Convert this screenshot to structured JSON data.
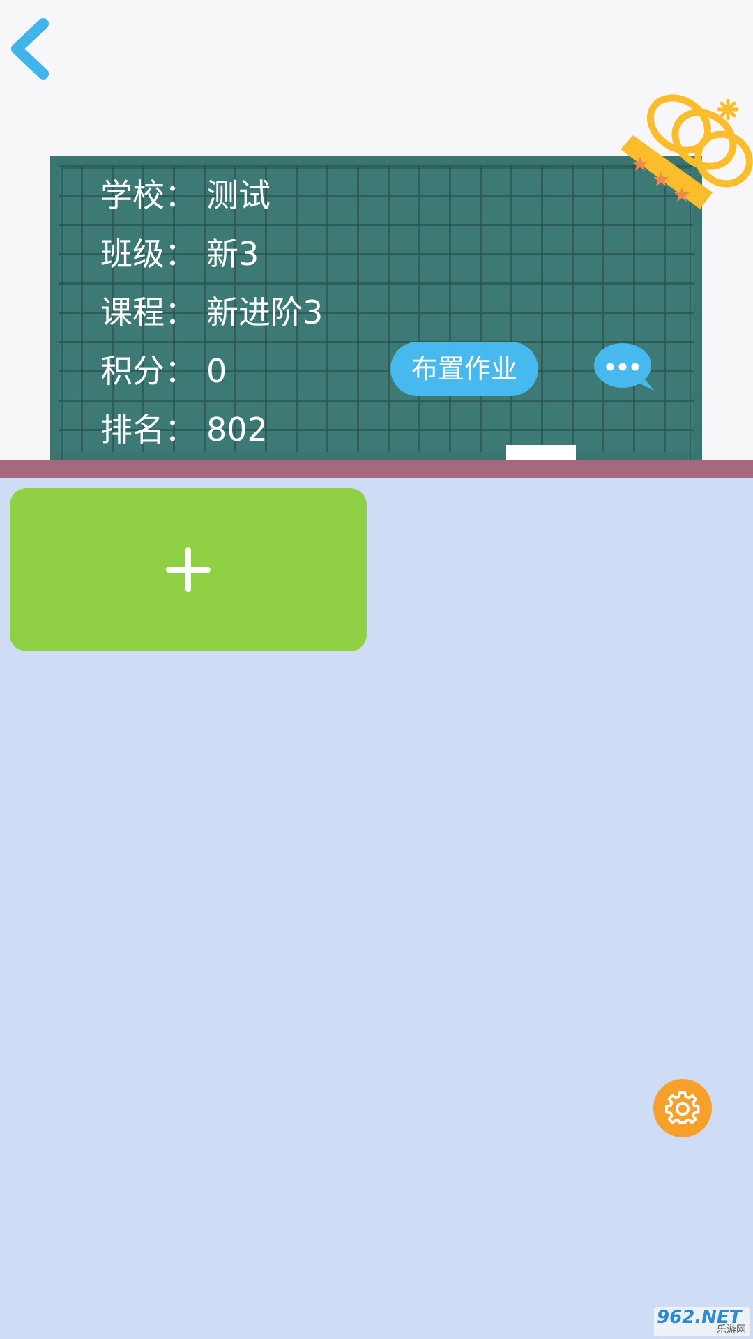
{
  "header": {
    "back_icon": "chevron-left-icon"
  },
  "board": {
    "rows": [
      {
        "label": "学校：",
        "value": "测试"
      },
      {
        "label": "班级：",
        "value": "新3"
      },
      {
        "label": "课程：",
        "value": "新进阶3"
      },
      {
        "label": "积分：",
        "value": "0"
      },
      {
        "label": "排名：",
        "value": "802"
      }
    ],
    "assign_button_label": "布置作业",
    "chat_icon": "chat-bubble-icon",
    "crown_icon": "crown-icon"
  },
  "homework": {
    "add_icon": "plus-icon"
  },
  "settings": {
    "icon": "gear-icon"
  },
  "watermark": {
    "brand": "962.NET",
    "subtitle": "乐游网"
  },
  "colors": {
    "board": "#3e7a75",
    "ledge": "#a6687c",
    "content_bg": "#cfdcf5",
    "add_card": "#8fd045",
    "accent_blue": "#47b9ee",
    "settings_orange": "#f7a02c",
    "crown_gold": "#fbbd2c"
  }
}
